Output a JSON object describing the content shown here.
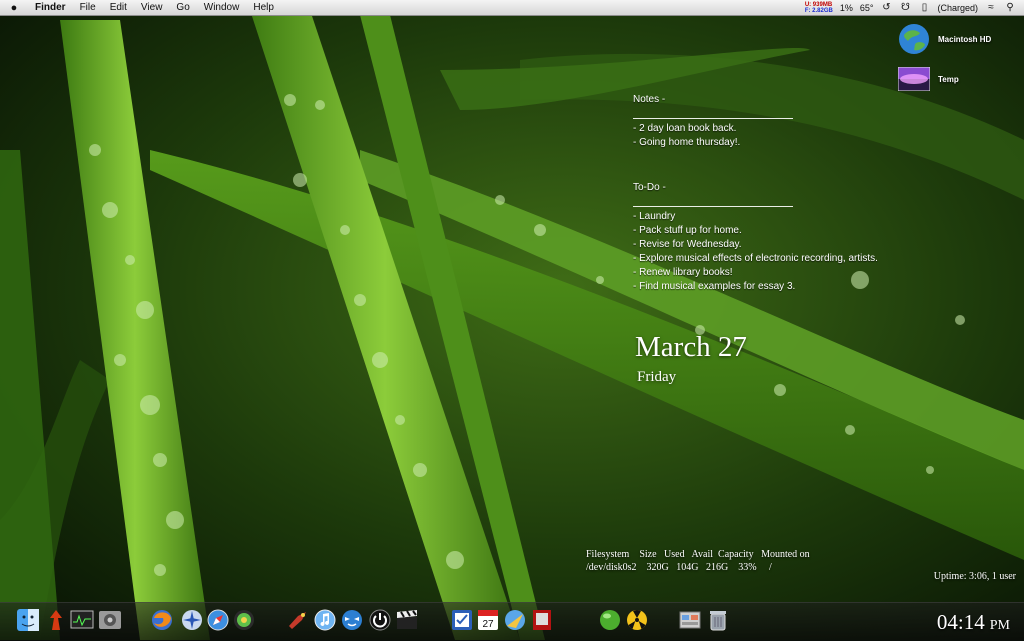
{
  "menubar": {
    "apple": "",
    "items": [
      "Finder",
      "File",
      "Edit",
      "View",
      "Go",
      "Window",
      "Help"
    ],
    "memory_used": "U: 939MB",
    "memory_free": "F: 2.82GB",
    "cpu": "1%",
    "temperature": "65°",
    "battery": "(Charged)"
  },
  "desktop_icons": [
    {
      "label": "Macintosh HD",
      "icon": "hard-drive-icon"
    },
    {
      "label": "Temp",
      "icon": "folder-icon"
    }
  ],
  "notes": {
    "notes_heading": "Notes -",
    "notes_items": [
      "- 2 day loan book back.",
      "- Going home thursday!."
    ],
    "todo_heading": "To-Do -",
    "todo_items": [
      "- Laundry",
      "- Pack stuff up for home.",
      "- Revise for Wednesday.",
      "- Explore musical effects of electronic recording, artists.",
      "- Renew library books!",
      "- Find musical examples for essay 3."
    ]
  },
  "date": {
    "month_day": "March 27",
    "weekday": "Friday"
  },
  "df": {
    "header": "Filesystem    Size   Used   Avail  Capacity   Mounted on",
    "row": "/dev/disk0s2    320G   104G   216G    33%     /"
  },
  "uptime": "Uptime: 3:06, 1 user",
  "clock": {
    "time": "04:14",
    "ampm": "PM"
  },
  "dock": {
    "items": [
      "finder-icon",
      "stack-icon",
      "activity-monitor-icon",
      "system-prefs-icon",
      "firefox-icon",
      "compass-icon",
      "safari-icon",
      "aperture-icon",
      "transmit-icon",
      "itunes-icon",
      "adium-icon",
      "quit-icon",
      "clapper-icon",
      "tasks-icon",
      "ical-icon",
      "mail-icon",
      "photo-booth-icon",
      "green-ball-icon",
      "radiation-icon",
      "documents-stack-icon",
      "trash-icon"
    ]
  }
}
